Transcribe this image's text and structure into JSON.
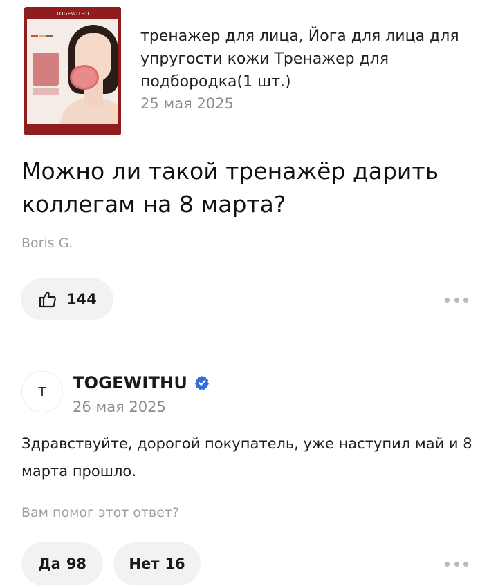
{
  "product": {
    "image": {
      "brand": "TOGEWITHU",
      "icon": "product-photo-face-trainer"
    },
    "title": "тренажер для лица, Йога для лица для упругости кожи Тренажер для подбородка(1 шт.)",
    "date": "25 мая 2025"
  },
  "question": {
    "text": "Можно ли такой тренажёр дарить коллегам на 8 марта?",
    "author": "Boris G.",
    "likes": "144",
    "like_icon": "thumbs-up-icon",
    "more_icon": "more-dots-icon"
  },
  "answer": {
    "avatar_letter": "T",
    "seller": "TOGEWITHU",
    "verified_icon": "verified-check-icon",
    "date": "26 мая 2025",
    "text": "Здравствуйте, дорогой покупатель, уже наступил май и 8 марта прошло.",
    "helpful_question": "Вам помог этот ответ?",
    "yes_label": "Да",
    "yes_count": "98",
    "no_label": "Нет",
    "no_count": "16",
    "more_icon": "more-dots-icon"
  },
  "colors": {
    "accent_blue": "#2f6fe0",
    "thumb_frame": "#8f1d1d",
    "muted_text": "#8c8c8c",
    "pill_bg": "#f2f2f4"
  }
}
